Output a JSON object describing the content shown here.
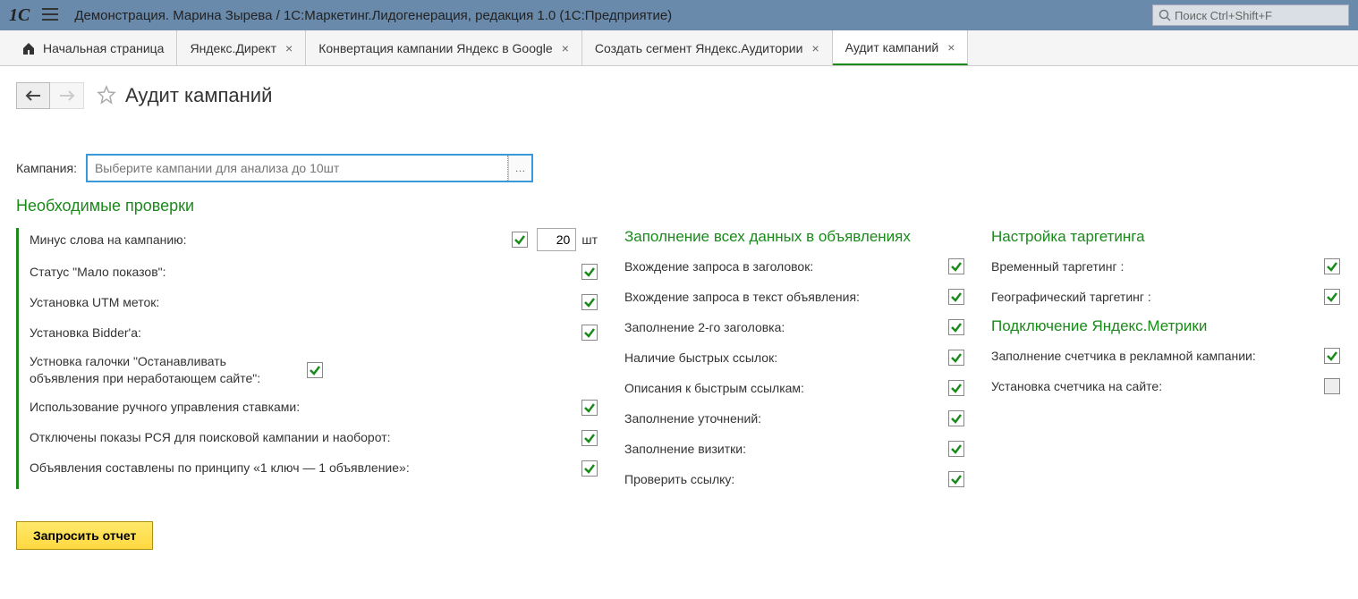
{
  "header": {
    "title": "Демонстрация. Марина Зырева / 1С:Маркетинг.Лидогенерация, редакция 1.0  (1С:Предприятие)",
    "search_placeholder": "Поиск Ctrl+Shift+F"
  },
  "tabs": {
    "home": "Начальная страница",
    "items": [
      {
        "label": "Яндекс.Директ"
      },
      {
        "label": "Конвертация кампании Яндекс в Google"
      },
      {
        "label": "Создать сегмент Яндекс.Аудитории"
      },
      {
        "label": "Аудит кампаний"
      }
    ]
  },
  "page": {
    "title": "Аудит кампаний",
    "campaign_label": "Кампания:",
    "campaign_placeholder": "Выберите кампании для анализа до 10шт",
    "section_title": "Необходимые проверки",
    "request_btn": "Запросить отчет"
  },
  "col1": {
    "r0": {
      "label": "Минус слова на кампанию:",
      "value": "20",
      "unit": "шт"
    },
    "r1": {
      "label": "Статус \"Мало показов\":"
    },
    "r2": {
      "label": "Установка UTM меток:"
    },
    "r3": {
      "label": "Установка Bidder'a:"
    },
    "r4": {
      "label": "Устновка галочки \"Останавливать объявления при неработающем сайте\":"
    },
    "r5": {
      "label": "Использование ручного управления ставками:"
    },
    "r6": {
      "label": "Отключены показы РСЯ для поисковой кампании и наоборот:"
    },
    "r7": {
      "label": "Объявления составлены по принципу «1 ключ — 1 объявление»:"
    }
  },
  "col2": {
    "hdr": "Заполнение всех данных в объявлениях",
    "r0": {
      "label": "Вхождение запроса в заголовок:"
    },
    "r1": {
      "label": "Вхождение запроса в текст объявления:"
    },
    "r2": {
      "label": "Заполнение 2-го заголовка:"
    },
    "r3": {
      "label": "Наличие быстрых ссылок:"
    },
    "r4": {
      "label": "Описания к быстрым ссылкам:"
    },
    "r5": {
      "label": "Заполнение уточнений:"
    },
    "r6": {
      "label": "Заполнение визитки:"
    },
    "r7": {
      "label": "Проверить ссылку:"
    }
  },
  "col3": {
    "hdr1": "Настройка таргетинга",
    "r0": {
      "label": "Временный таргетинг :"
    },
    "r1": {
      "label": "Географический таргетинг :"
    },
    "hdr2": "Подключение Яндекс.Метрики",
    "r2": {
      "label": "Заполнение счетчика в рекламной кампании:"
    },
    "r3": {
      "label": "Установка счетчика на сайте:"
    }
  }
}
